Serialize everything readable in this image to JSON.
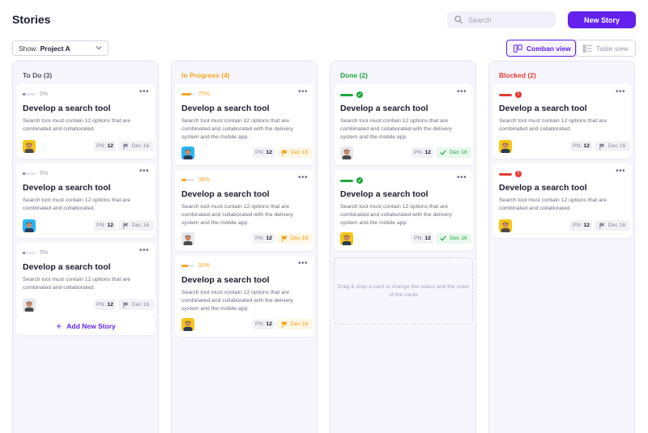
{
  "header": {
    "title": "Stories",
    "search_placeholder": "Search",
    "new_story_label": "New Story"
  },
  "filter": {
    "show_label": "Show:",
    "project": "Project A"
  },
  "views": {
    "comban": "Comban view",
    "table": "Table view"
  },
  "colors": {
    "accent": "#6320ee",
    "todo": "#55536a",
    "in_progress": "#f5a623",
    "done": "#1ea83c",
    "blocked": "#e53935"
  },
  "columns": [
    {
      "title": "To Do (3)",
      "color": "#55536a",
      "cards": [
        {
          "progress": "5%",
          "progress_value": 0.05,
          "title": "Develop a search tool",
          "desc": "Search tool must contain 12 options that are combinated and collaborated.",
          "pn_label": "PN:",
          "pn": "12",
          "due": "Dec 16",
          "due_type": "flag-gray"
        },
        {
          "progress": "5%",
          "progress_value": 0.05,
          "title": "Develop a search tool",
          "desc": "Search tool must contain 12 options that are combinated and collaborated.",
          "pn_label": "PN:",
          "pn": "12",
          "due": "Dec 16",
          "due_type": "flag-gray"
        },
        {
          "progress": "5%",
          "progress_value": 0.05,
          "title": "Develop a search tool",
          "desc": "Search tool must contain 12 options that are combinated and collaborated.",
          "pn_label": "PN:",
          "pn": "12",
          "due": "Dec 16",
          "due_type": "flag-gray"
        }
      ],
      "add_label": "Add New Story"
    },
    {
      "title": "In Progress (4)",
      "color": "#f5a623",
      "cards": [
        {
          "progress": "75%",
          "progress_value": 0.75,
          "title": "Develop a search tool",
          "desc": "Search tool must contain 12 options that are combinated and collaborated with the delivery system and the mobile app.",
          "pn_label": "PN:",
          "pn": "12",
          "due": "Dec 16",
          "due_type": "flag-orange"
        },
        {
          "progress": "38%",
          "progress_value": 0.38,
          "title": "Develop a search tool",
          "desc": "Search tool must contain 12 options that are combinated and collaborated with the delivery system and the mobile app.",
          "pn_label": "PN:",
          "pn": "12",
          "due": "Dec 16",
          "due_type": "flag-orange"
        },
        {
          "progress": "50%",
          "progress_value": 0.5,
          "title": "Develop a search tool",
          "desc": "Search tool must contain 12 options that are combinated and collaborated with the delivery system and the mobile app.",
          "pn_label": "PN:",
          "pn": "12",
          "due": "Dec 16",
          "due_type": "flag-orange"
        }
      ]
    },
    {
      "title": "Done (2)",
      "color": "#1ea83c",
      "cards": [
        {
          "progress_value": 1,
          "title": "Develop a search tool",
          "desc": "Search tool must contain 12 options that are combinated and collaborated with the delivery system and the mobile app.",
          "pn_label": "PN:",
          "pn": "12",
          "due": "Dec 16",
          "due_type": "check-green"
        },
        {
          "progress_value": 1,
          "title": "Develop a search tool",
          "desc": "Search tool must contain 12 options that are combinated and collaborated with the delivery system and the mobile app.",
          "pn_label": "PN:",
          "pn": "12",
          "due": "Dec 16",
          "due_type": "check-green"
        }
      ],
      "dropzone": "Drag & drop a card to change the status and the order of the cards"
    },
    {
      "title": "Blocked (2)",
      "color": "#e53935",
      "cards": [
        {
          "progress_value": 1,
          "title": "Develop a search tool",
          "desc": "Search tool must contain 12 options that are combinated and collaborated.",
          "pn_label": "PN:",
          "pn": "12",
          "due": "Dec 16",
          "due_type": "flag-gray"
        },
        {
          "progress_value": 1,
          "title": "Develop a search tool",
          "desc": "Search tool must contain 12 options that are combinated and collaborated.",
          "pn_label": "PN:",
          "pn": "12",
          "due": "Dec 16",
          "due_type": "flag-gray"
        }
      ]
    }
  ]
}
